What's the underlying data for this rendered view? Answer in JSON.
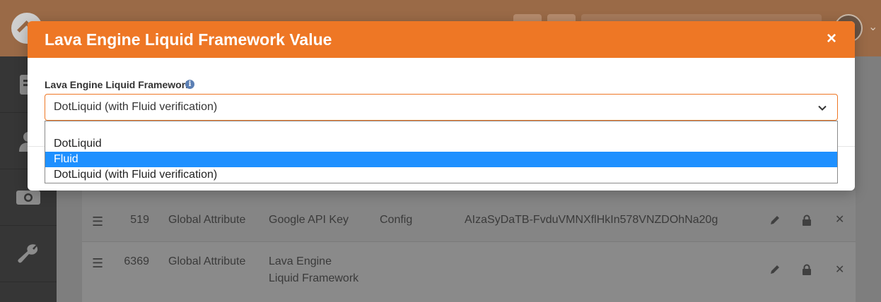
{
  "background": {
    "grid_rows": [
      {
        "id": "519",
        "entity": "Global Attribute",
        "name": "Google API Key",
        "category": "Config",
        "value": "AIzaSyDaTB-FvduVMNXflHkIn578VNZDOhNa20g"
      },
      {
        "id": "6369",
        "entity": "Global Attribute",
        "name_line1": "Lava Engine",
        "name_line2": "Liquid Framework",
        "category": "",
        "value": ""
      }
    ]
  },
  "modal": {
    "title": "Lava Engine Liquid Framework Value",
    "close_glyph": "×",
    "field_label": "Lava Engine Liquid Framework",
    "info_glyph": "i",
    "select_value": "DotLiquid (with Fluid verification)",
    "options": [
      {
        "label": "",
        "highlighted": false
      },
      {
        "label": "DotLiquid",
        "highlighted": false
      },
      {
        "label": "Fluid",
        "highlighted": true
      },
      {
        "label": "DotLiquid (with Fluid verification)",
        "highlighted": false
      }
    ]
  },
  "colors": {
    "accent": "#ee7725",
    "highlight": "#1e90ff",
    "info": "#5b7fb4"
  },
  "icons": {
    "sidebar": [
      "document-icon",
      "person-icon",
      "money-icon",
      "wrench-icon"
    ],
    "row_actions": [
      "pencil-icon",
      "lock-icon",
      "close-icon"
    ],
    "row_handle": "drag-handle-icon"
  }
}
